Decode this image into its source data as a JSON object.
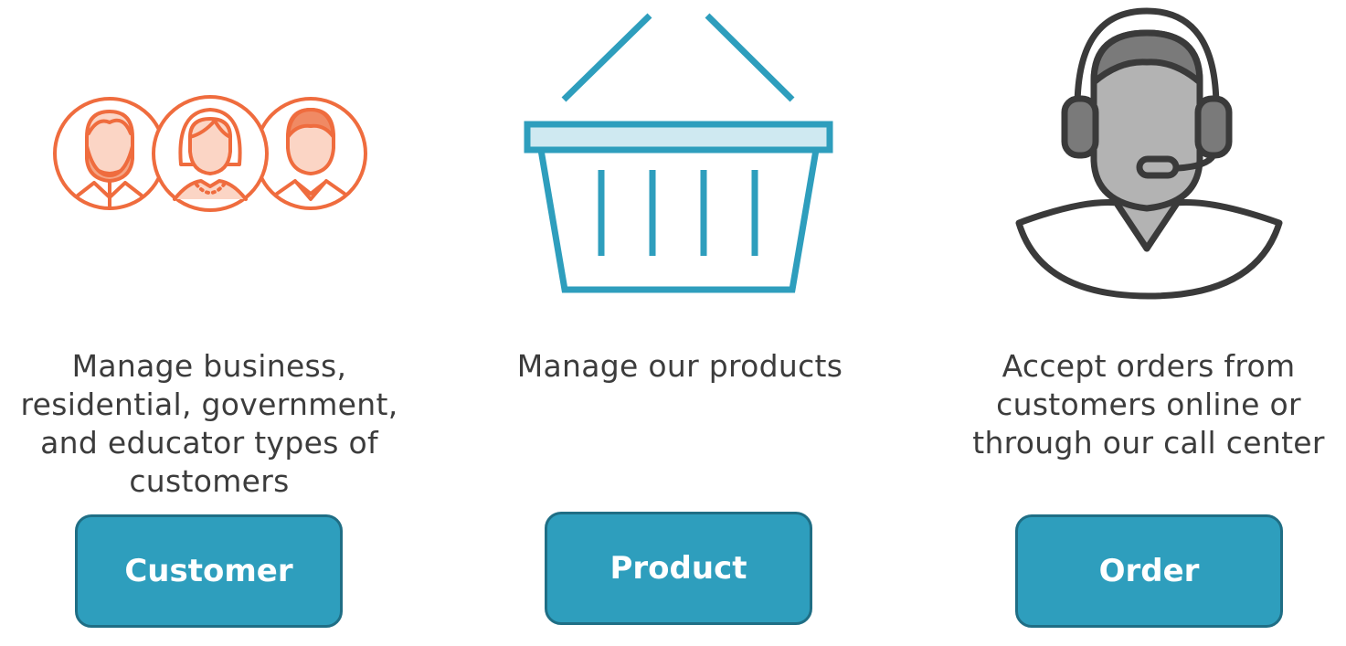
{
  "columns": [
    {
      "icon": "customers-group-icon",
      "description_lines": [
        "Manage business,",
        "residential, government,",
        "and educator types of",
        "customers"
      ],
      "button_label": "Customer"
    },
    {
      "icon": "shopping-basket-icon",
      "description_lines": [
        "Manage our products"
      ],
      "button_label": "Product"
    },
    {
      "icon": "call-center-agent-icon",
      "description_lines": [
        "Accept orders from",
        "customers online or",
        "through our call center"
      ],
      "button_label": "Order"
    }
  ],
  "colors": {
    "customer_icon": "#ef6c3e",
    "customer_icon_fill": "#fbd5c5",
    "basket_icon": "#2e9ebd",
    "basket_rim_fill": "#cfe9f1",
    "agent_outline": "#3a3a3a",
    "agent_fill": "#b3b3b3",
    "agent_dark": "#7a7a7a",
    "button_bg": "#2e9ebd",
    "button_border": "#1f6e85",
    "text": "#3c3c3c"
  }
}
